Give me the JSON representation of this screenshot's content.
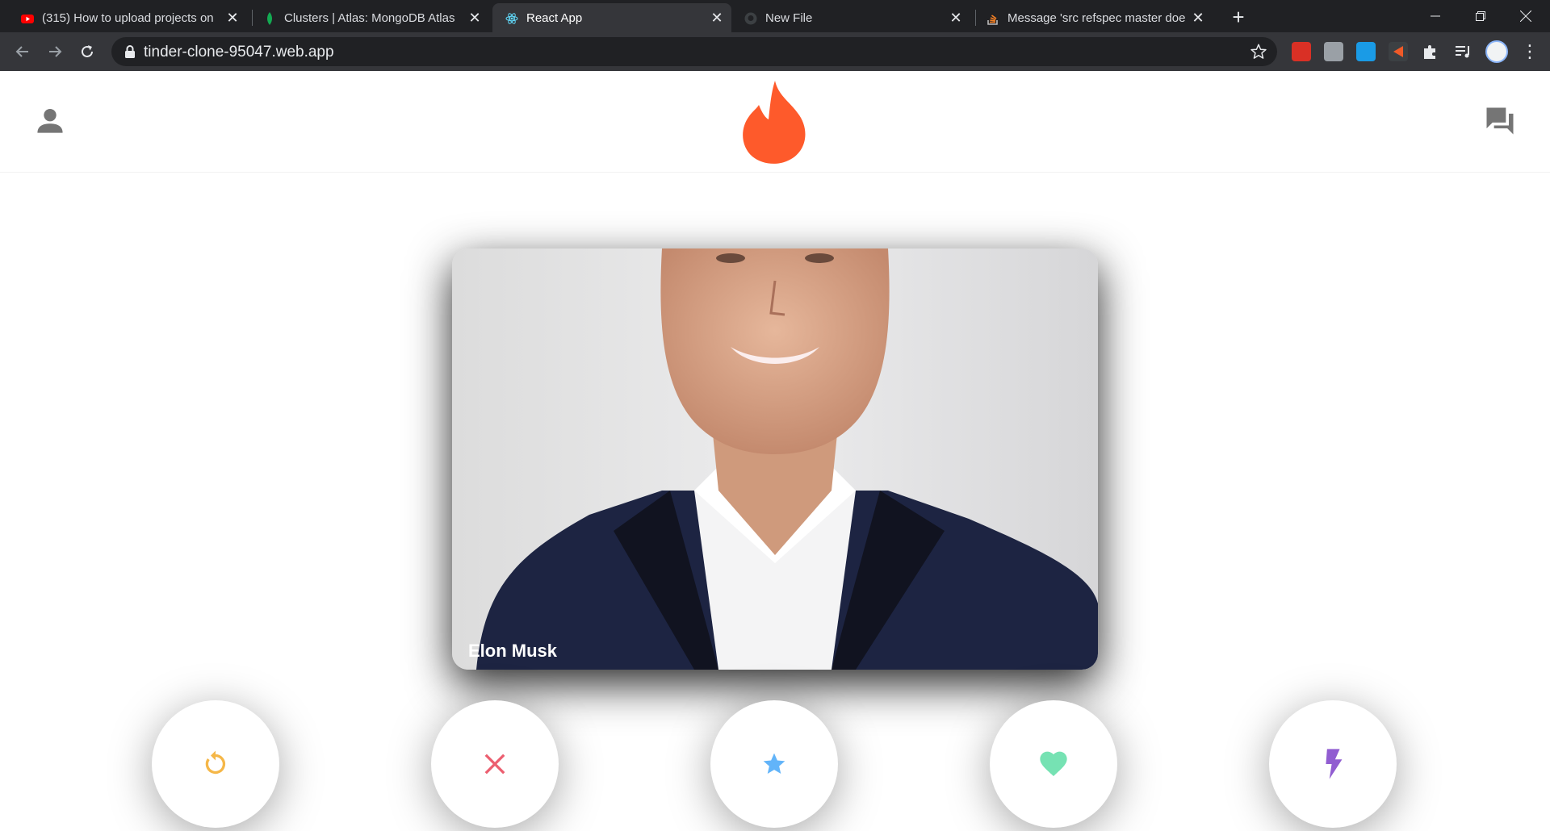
{
  "browser": {
    "tabs": [
      {
        "title": "(315) How to upload projects on",
        "favicon": "youtube-icon",
        "active": false
      },
      {
        "title": "Clusters | Atlas: MongoDB Atlas",
        "favicon": "mongodb-leaf-icon",
        "active": false
      },
      {
        "title": "React App",
        "favicon": "react-icon",
        "active": true
      },
      {
        "title": "New File",
        "favicon": "github-icon",
        "active": false
      },
      {
        "title": "Message 'src refspec master doe",
        "favicon": "stackoverflow-icon",
        "active": false
      }
    ],
    "url": "tinder-clone-95047.web.app"
  },
  "app": {
    "logo": "tinder-flame-icon",
    "card": {
      "name": "Elon Musk"
    },
    "buttons": [
      {
        "name": "replay-button",
        "icon": "replay-icon",
        "color": "#f5b748"
      },
      {
        "name": "nope-button",
        "icon": "close-icon",
        "color": "#ec5e6f"
      },
      {
        "name": "super-like-button",
        "icon": "star-icon",
        "color": "#62b4f9"
      },
      {
        "name": "like-button",
        "icon": "heart-icon",
        "color": "#76e2b3"
      },
      {
        "name": "boost-button",
        "icon": "flash-icon",
        "color": "#915dd1"
      }
    ]
  },
  "colors": {
    "brand": "#fe5a2b",
    "header_icon": "#757575"
  }
}
